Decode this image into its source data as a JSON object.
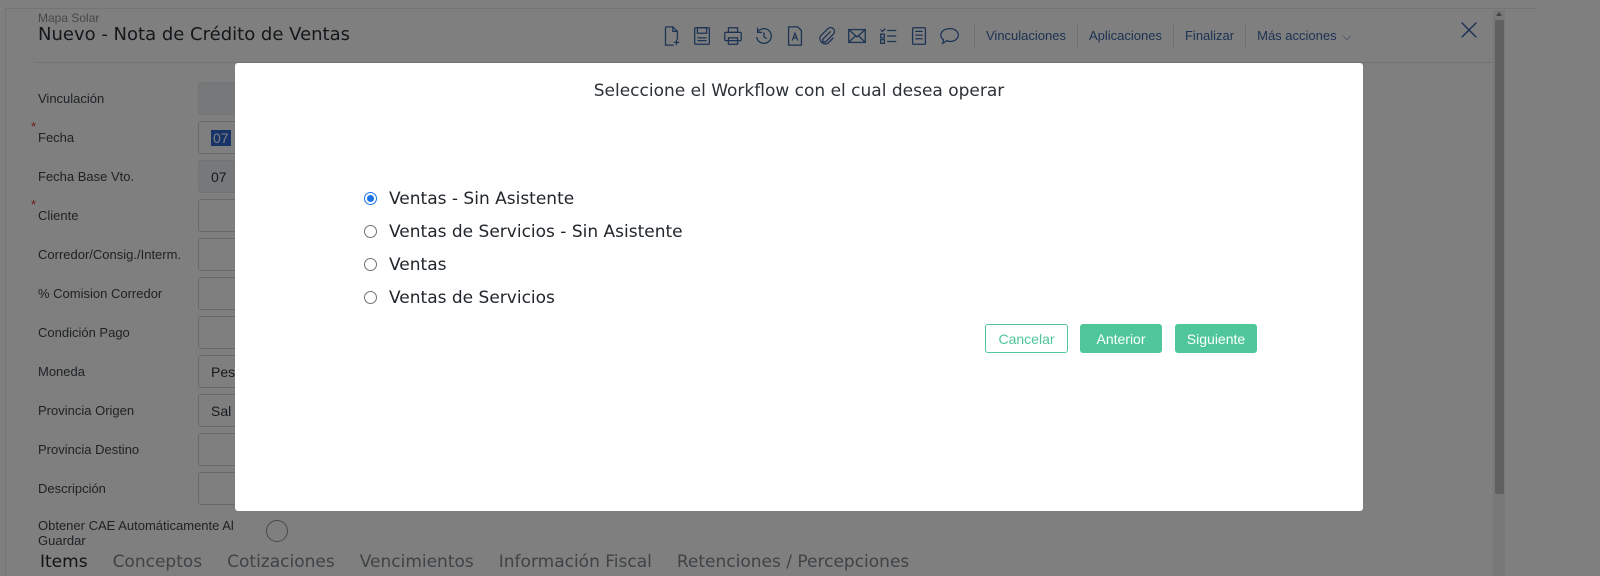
{
  "header": {
    "subtitle": "Mapa Solar",
    "title": "Nuevo - Nota de Crédito de Ventas"
  },
  "toolbar": {
    "icons": [
      "new-document-icon",
      "save-icon",
      "print-icon",
      "history-icon",
      "text-document-icon",
      "attachment-icon",
      "email-icon",
      "checklist-icon",
      "document-list-icon",
      "comment-icon",
      "close-icon"
    ],
    "links": [
      "Vinculaciones",
      "Aplicaciones",
      "Finalizar",
      "Más acciones"
    ]
  },
  "form": {
    "fields": [
      {
        "label": "Vinculación",
        "required": false,
        "value": ""
      },
      {
        "label": "Fecha",
        "required": true,
        "value": "07"
      },
      {
        "label": "Fecha Base Vto.",
        "required": false,
        "value": "07"
      },
      {
        "label": "Cliente",
        "required": true,
        "value": ""
      },
      {
        "label": "Corredor/Consig./Interm.",
        "required": false,
        "value": ""
      },
      {
        "label": "% Comision Corredor",
        "required": false,
        "value": ""
      },
      {
        "label": "Condición Pago",
        "required": false,
        "value": ""
      },
      {
        "label": "Moneda",
        "required": false,
        "value": "Pes"
      },
      {
        "label": "Provincia Origen",
        "required": false,
        "value": "Sal"
      },
      {
        "label": "Provincia Destino",
        "required": false,
        "value": ""
      },
      {
        "label": "Descripción",
        "required": false,
        "value": ""
      }
    ],
    "cae_label": "Obtener CAE Automáticamente Al Guardar"
  },
  "tabs": [
    "Items",
    "Conceptos",
    "Cotizaciones",
    "Vencimientos",
    "Información Fiscal",
    "Retenciones / Percepciones"
  ],
  "modal": {
    "title": "Seleccione el Workflow con el cual desea operar",
    "options": [
      {
        "label": "Ventas - Sin Asistente",
        "checked": true
      },
      {
        "label": "Ventas de Servicios - Sin Asistente",
        "checked": false
      },
      {
        "label": "Ventas",
        "checked": false
      },
      {
        "label": "Ventas de Servicios",
        "checked": false
      }
    ],
    "buttons": {
      "cancel": "Cancelar",
      "previous": "Anterior",
      "next": "Siguiente"
    }
  },
  "colors": {
    "accent": "#4fc79a",
    "link": "#3a66a8",
    "radio_checked": "#1a73e8"
  }
}
